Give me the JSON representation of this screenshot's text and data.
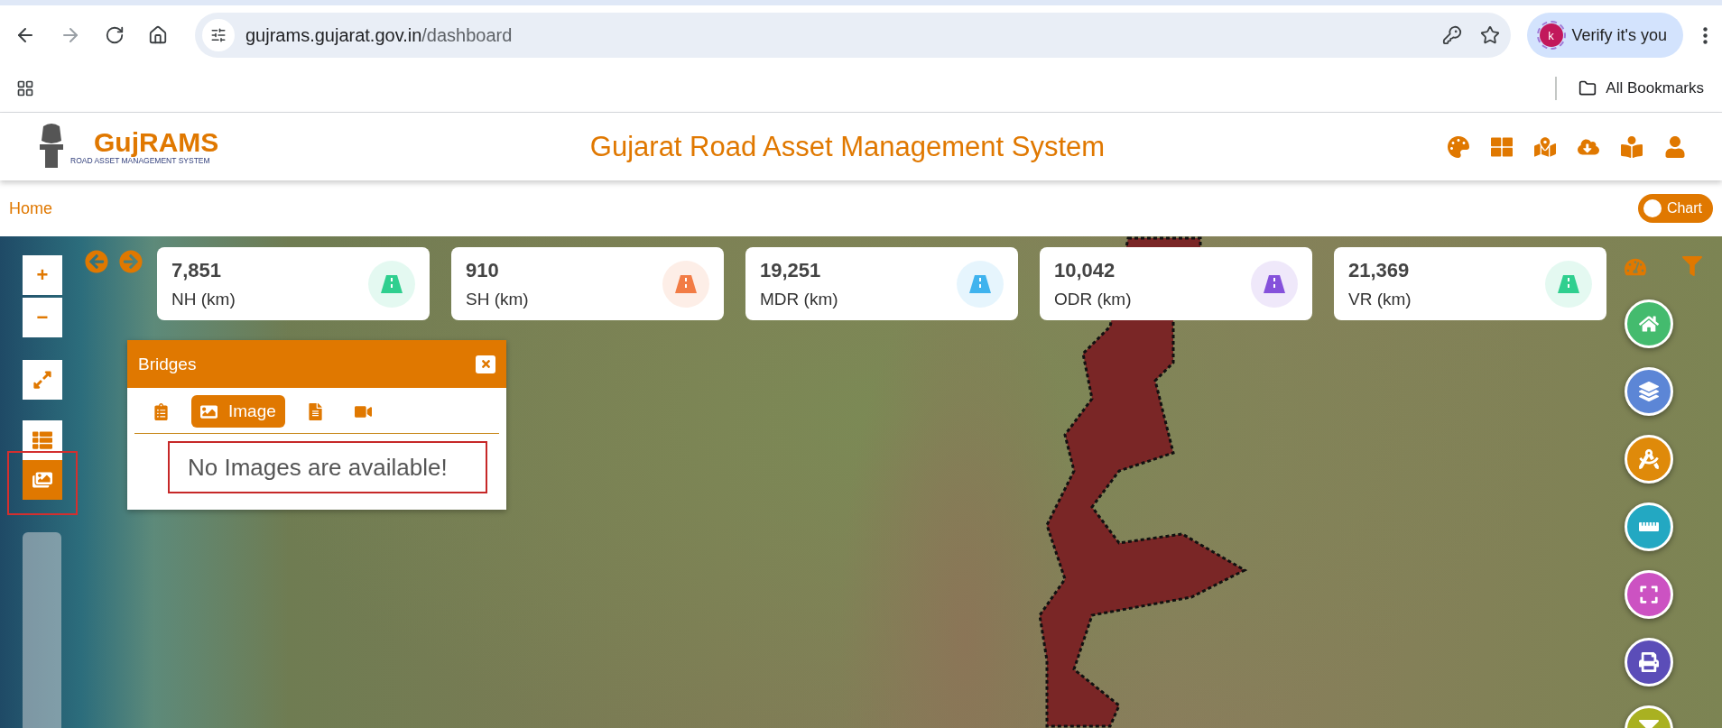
{
  "browser": {
    "url_host": "gujrams.gujarat.gov.in",
    "url_path": "/dashboard",
    "profile_initial": "k",
    "profile_label": "Verify it's you",
    "bookmarks_label": "All Bookmarks"
  },
  "header": {
    "logo_title": "GujRAMS",
    "logo_subtitle": "ROAD ASSET MANAGEMENT SYSTEM",
    "title": "Gujarat Road Asset Management System"
  },
  "breadcrumb": "Home",
  "chart_toggle": {
    "label": "Chart",
    "on": false
  },
  "stats": [
    {
      "value": "7,851",
      "label": "NH (km)",
      "color": "#2fcf8f"
    },
    {
      "value": "910",
      "label": "SH (km)",
      "color": "#f27c45"
    },
    {
      "value": "19,251",
      "label": "MDR (km)",
      "color": "#3fb3ee"
    },
    {
      "value": "10,042",
      "label": "ODR (km)",
      "color": "#8551db"
    },
    {
      "value": "21,369",
      "label": "VR (km)",
      "color": "#2fcf8f"
    }
  ],
  "map_controls": [
    {
      "kind": "zoom_in",
      "label": "+",
      "selected": false
    },
    {
      "kind": "zoom_out",
      "label": "−",
      "selected": false
    },
    {
      "kind": "extent",
      "selected": false
    },
    {
      "kind": "table",
      "selected": false
    },
    {
      "kind": "gallery",
      "selected": true
    }
  ],
  "popup": {
    "title": "Bridges",
    "tabs": [
      {
        "kind": "details",
        "selected": false
      },
      {
        "kind": "image",
        "label": "Image",
        "selected": true
      },
      {
        "kind": "document",
        "selected": false
      },
      {
        "kind": "video",
        "selected": false
      }
    ],
    "message": "No Images are available!"
  },
  "right_tools": [
    {
      "kind": "home",
      "color": "#44bb6e"
    },
    {
      "kind": "layers",
      "color": "#5c86d6"
    },
    {
      "kind": "compass",
      "color": "#df8a0a"
    },
    {
      "kind": "ruler",
      "color": "#23a8c2"
    },
    {
      "kind": "fullscreen",
      "color": "#cc52c2"
    },
    {
      "kind": "print",
      "color": "#5b4db8"
    },
    {
      "kind": "filter",
      "color": "#a9b121"
    }
  ]
}
